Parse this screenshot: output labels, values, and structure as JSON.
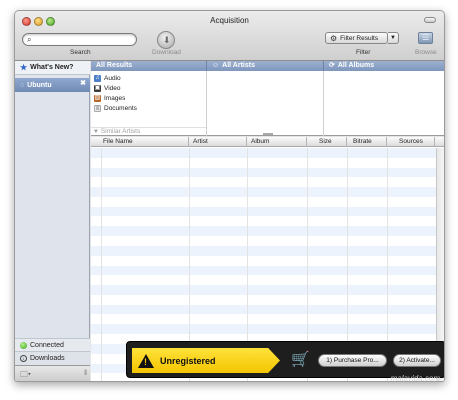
{
  "window": {
    "title": "Acquisition"
  },
  "toolbar": {
    "search_label": "Search",
    "search_value": "",
    "download_label": "Download",
    "filter_button": "Filter Results",
    "filter_dropdown": "▼",
    "filter_label": "Filter",
    "browse_label": "Browse"
  },
  "sidebar": {
    "whats_new": "What's New?",
    "ubuntu": "Ubuntu",
    "connected": "Connected",
    "downloads": "Downloads"
  },
  "browser": {
    "col1_header": "All Results",
    "col2_header": "All Artists",
    "col3_header": "All Albums",
    "results": [
      {
        "label": "Audio",
        "icon": "audio-icon"
      },
      {
        "label": "Video",
        "icon": "video-icon"
      },
      {
        "label": "Images",
        "icon": "images-icon"
      },
      {
        "label": "Documents",
        "icon": "documents-icon"
      }
    ],
    "similar_artists": "Similar Artists"
  },
  "table": {
    "columns": [
      "File Name",
      "Artist",
      "Album",
      "Size",
      "Bitrate",
      "Sources"
    ]
  },
  "banner": {
    "status": "Unregistered",
    "purchase": "1) Purchase Pro...",
    "activate": "2) Activate..."
  },
  "watermark": "malavida.com",
  "colors": {
    "selection": "#7f96bd",
    "warning": "#f3c500",
    "row_alt": "#edf3fd"
  }
}
